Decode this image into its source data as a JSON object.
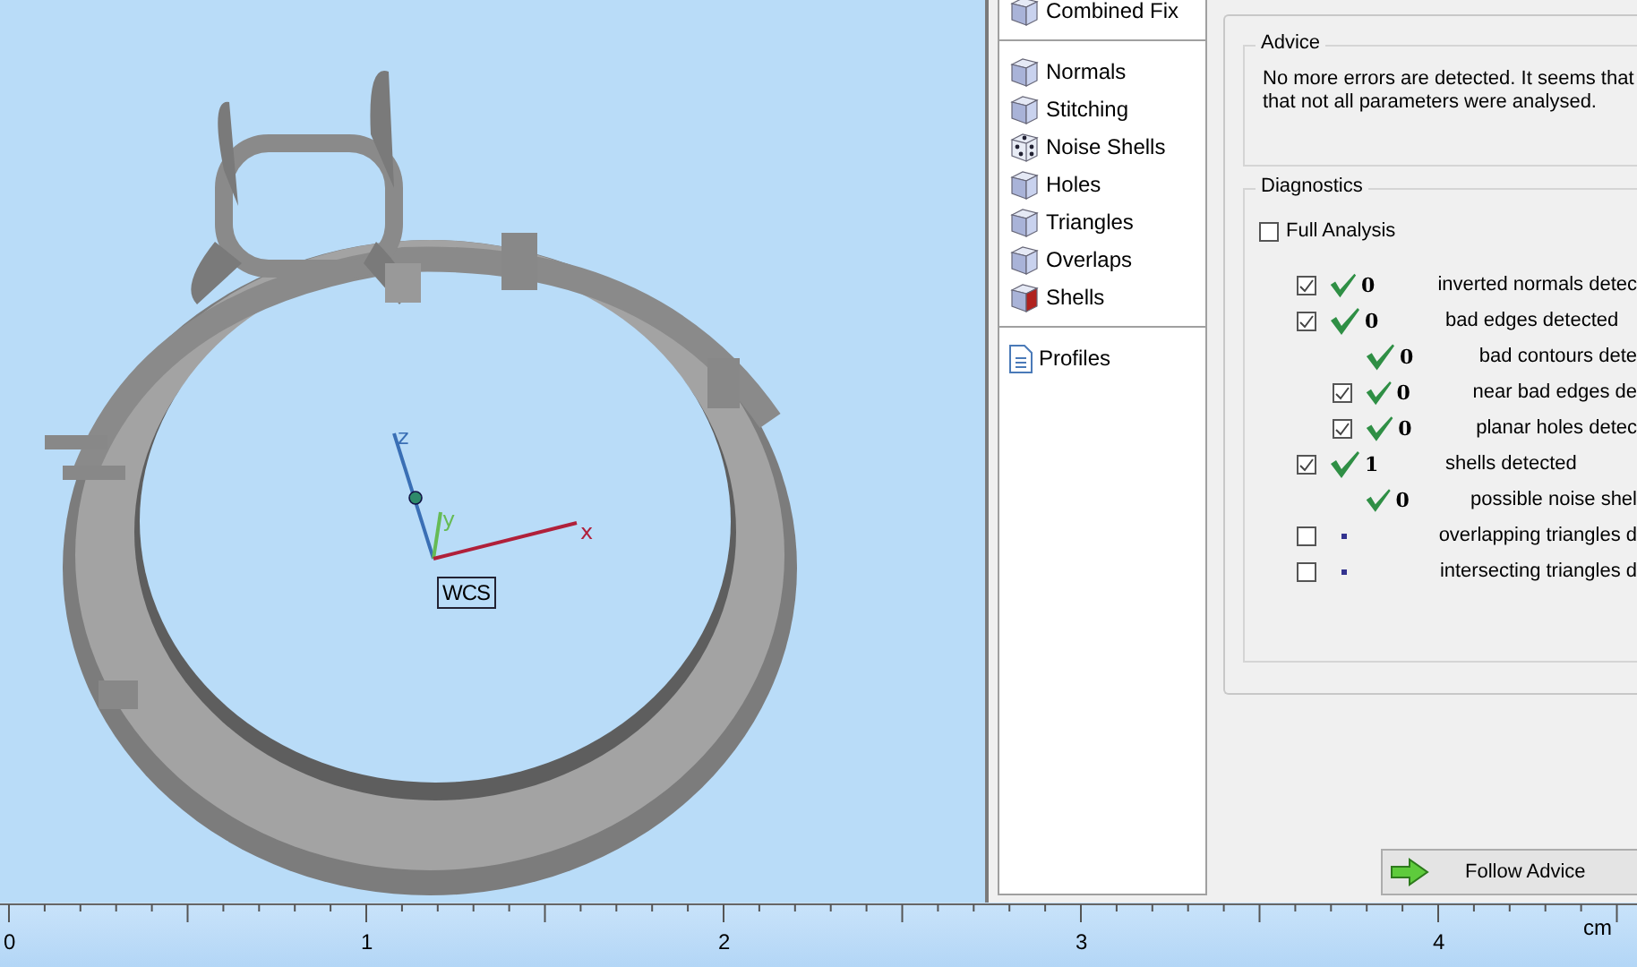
{
  "viewport": {
    "axes": {
      "x_label": "x",
      "y_label": "y",
      "z_label": "z",
      "origin_label": "WCS"
    }
  },
  "ruler": {
    "labels": [
      "0",
      "1",
      "2",
      "3",
      "4"
    ],
    "unit": "cm"
  },
  "sidebar": {
    "groups": [
      {
        "items": [
          {
            "label": "Combined Fix",
            "kind": "cube"
          }
        ]
      },
      {
        "items": [
          {
            "label": "Normals",
            "kind": "cube"
          },
          {
            "label": "Stitching",
            "kind": "cube"
          },
          {
            "label": "Noise Shells",
            "kind": "dice"
          },
          {
            "label": "Holes",
            "kind": "cube"
          },
          {
            "label": "Triangles",
            "kind": "cube"
          },
          {
            "label": "Overlaps",
            "kind": "cube"
          },
          {
            "label": "Shells",
            "kind": "cube"
          }
        ]
      },
      {
        "items": [
          {
            "label": "Profiles",
            "kind": "document"
          }
        ]
      }
    ]
  },
  "advice": {
    "title": "Advice",
    "lines": [
      "No more errors are detected. It seems that",
      "that not all parameters were analysed."
    ]
  },
  "diagnostics": {
    "title": "Diagnostics",
    "full_analysis": {
      "label": "Full Analysis",
      "checked": false
    },
    "rows": [
      {
        "kind": "checkbox",
        "checked": true,
        "passed": true,
        "count": "0",
        "label": "inverted normals detec"
      },
      {
        "kind": "checkbox",
        "checked": true,
        "passed": true,
        "count": "0",
        "label": "bad edges detected",
        "children": [
          {
            "kind": "plain",
            "passed": true,
            "count": "0",
            "label": "bad contours dete"
          },
          {
            "kind": "checkbox",
            "checked": true,
            "passed": true,
            "count": "0",
            "label": "near bad edges de"
          },
          {
            "kind": "checkbox",
            "checked": true,
            "passed": true,
            "count": "0",
            "label": "planar holes detec"
          }
        ]
      },
      {
        "kind": "checkbox",
        "checked": true,
        "passed": true,
        "count": "1",
        "label": "shells detected",
        "children": [
          {
            "kind": "plain",
            "passed": true,
            "count": "0",
            "label": "possible noise shel"
          }
        ]
      },
      {
        "kind": "checkbox",
        "checked": false,
        "passed": false,
        "label": "overlapping triangles d"
      },
      {
        "kind": "checkbox",
        "checked": false,
        "passed": false,
        "label": "intersecting triangles d"
      }
    ]
  },
  "follow_button": {
    "label": "Follow Advice"
  }
}
